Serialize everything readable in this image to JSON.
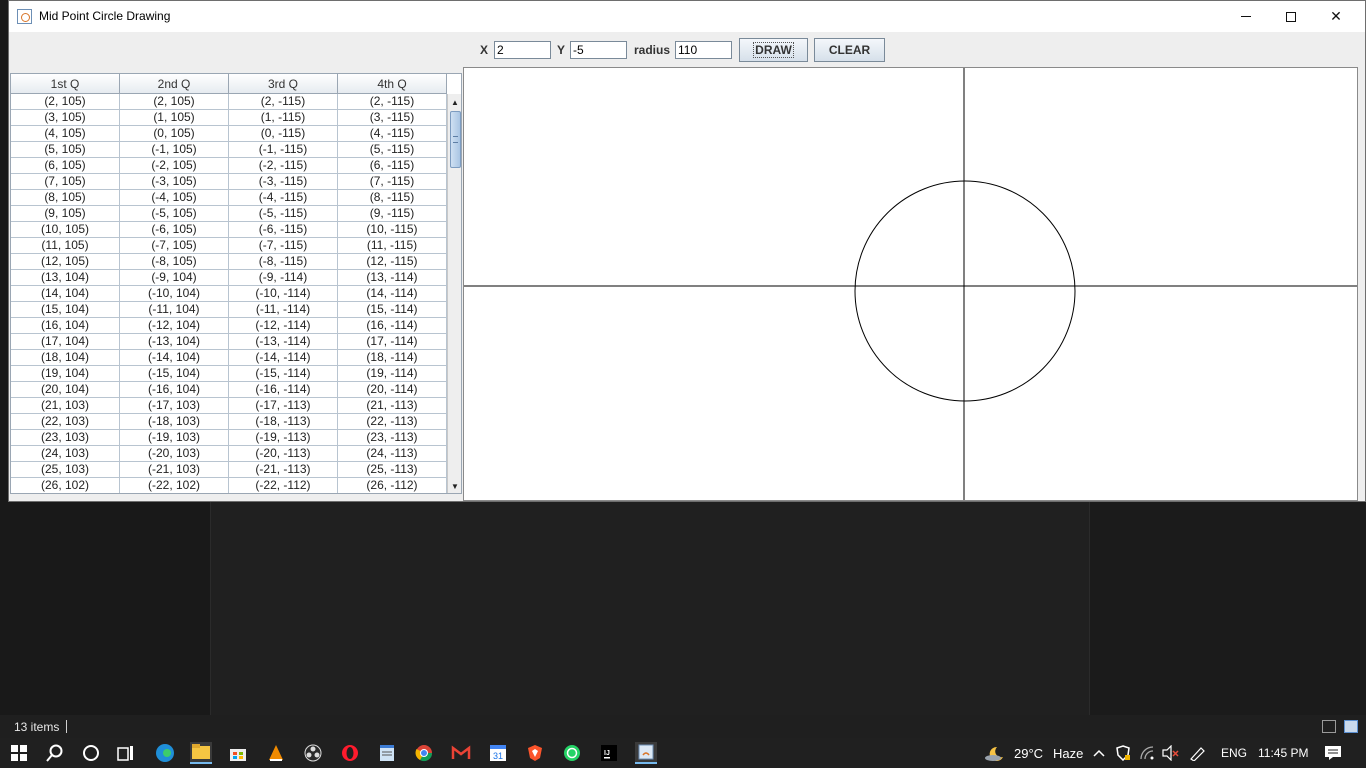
{
  "window": {
    "title": "Mid Point Circle Drawing",
    "icon": "java-icon"
  },
  "controls": {
    "x_label": "X",
    "x_value": "2",
    "y_label": "Y",
    "y_value": "-5",
    "radius_label": "radius",
    "radius_value": "110",
    "draw_label": "DRAW",
    "clear_label": "CLEAR"
  },
  "table": {
    "headers": [
      "1st Q",
      "2nd Q",
      "3rd Q",
      "4th Q"
    ],
    "rows": [
      [
        "(2, 105)",
        "(2, 105)",
        "(2, -115)",
        "(2, -115)"
      ],
      [
        "(3, 105)",
        "(1, 105)",
        "(1, -115)",
        "(3, -115)"
      ],
      [
        "(4, 105)",
        "(0, 105)",
        "(0, -115)",
        "(4, -115)"
      ],
      [
        "(5, 105)",
        "(-1, 105)",
        "(-1, -115)",
        "(5, -115)"
      ],
      [
        "(6, 105)",
        "(-2, 105)",
        "(-2, -115)",
        "(6, -115)"
      ],
      [
        "(7, 105)",
        "(-3, 105)",
        "(-3, -115)",
        "(7, -115)"
      ],
      [
        "(8, 105)",
        "(-4, 105)",
        "(-4, -115)",
        "(8, -115)"
      ],
      [
        "(9, 105)",
        "(-5, 105)",
        "(-5, -115)",
        "(9, -115)"
      ],
      [
        "(10, 105)",
        "(-6, 105)",
        "(-6, -115)",
        "(10, -115)"
      ],
      [
        "(11, 105)",
        "(-7, 105)",
        "(-7, -115)",
        "(11, -115)"
      ],
      [
        "(12, 105)",
        "(-8, 105)",
        "(-8, -115)",
        "(12, -115)"
      ],
      [
        "(13, 104)",
        "(-9, 104)",
        "(-9, -114)",
        "(13, -114)"
      ],
      [
        "(14, 104)",
        "(-10, 104)",
        "(-10, -114)",
        "(14, -114)"
      ],
      [
        "(15, 104)",
        "(-11, 104)",
        "(-11, -114)",
        "(15, -114)"
      ],
      [
        "(16, 104)",
        "(-12, 104)",
        "(-12, -114)",
        "(16, -114)"
      ],
      [
        "(17, 104)",
        "(-13, 104)",
        "(-13, -114)",
        "(17, -114)"
      ],
      [
        "(18, 104)",
        "(-14, 104)",
        "(-14, -114)",
        "(18, -114)"
      ],
      [
        "(19, 104)",
        "(-15, 104)",
        "(-15, -114)",
        "(19, -114)"
      ],
      [
        "(20, 104)",
        "(-16, 104)",
        "(-16, -114)",
        "(20, -114)"
      ],
      [
        "(21, 103)",
        "(-17, 103)",
        "(-17, -113)",
        "(21, -113)"
      ],
      [
        "(22, 103)",
        "(-18, 103)",
        "(-18, -113)",
        "(22, -113)"
      ],
      [
        "(23, 103)",
        "(-19, 103)",
        "(-19, -113)",
        "(23, -113)"
      ],
      [
        "(24, 103)",
        "(-20, 103)",
        "(-20, -113)",
        "(24, -113)"
      ],
      [
        "(25, 103)",
        "(-21, 103)",
        "(-21, -113)",
        "(25, -113)"
      ],
      [
        "(26, 102)",
        "(-22, 102)",
        "(-22, -112)",
        "(26, -112)"
      ]
    ]
  },
  "explorer": {
    "status_items": "13 items"
  },
  "taskbar": {
    "weather_temp": "29°C",
    "weather_desc": "Haze",
    "language": "ENG",
    "time": "11:45 PM",
    "apps": [
      "windows-start-icon",
      "search-icon",
      "cortana-icon",
      "task-view-icon",
      "edge-icon",
      "file-explorer-icon",
      "store-icon",
      "vlc-icon",
      "obs-icon",
      "opera-icon",
      "notepad-icon",
      "chrome-icon",
      "gmail-icon",
      "calendar-icon",
      "brave-icon",
      "whatsapp-icon",
      "intellij-icon",
      "java-app-icon"
    ],
    "calendar_day": "31",
    "intellij_label": "IJ"
  },
  "colors": {
    "window_bg": "#eeeeee",
    "taskbar_bg": "#202020",
    "accent": "#76b9ed"
  }
}
